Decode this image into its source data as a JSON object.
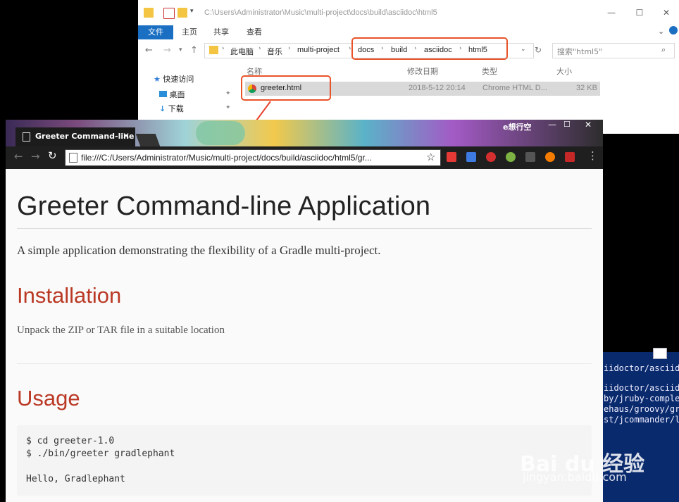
{
  "explorer": {
    "title": "C:\\Users\\Administrator\\Music\\multi-project\\docs\\build\\asciidoc\\html5",
    "ribbon": {
      "file": "文件",
      "home": "主页",
      "share": "共享",
      "view": "查看"
    },
    "breadcrumbs": [
      "此电脑",
      "音乐",
      "multi-project",
      "docs",
      "build",
      "asciidoc",
      "html5"
    ],
    "search_placeholder": "搜索\"html5\"",
    "nav": {
      "quick_access": "快速访问",
      "desktop": "桌面",
      "downloads": "下载"
    },
    "columns": {
      "name": "名称",
      "modified": "修改日期",
      "type": "类型",
      "size": "大小"
    },
    "file": {
      "name": "greeter.html",
      "modified": "2018-5-12 20:14",
      "type": "Chrome HTML D...",
      "size": "32 KB"
    },
    "window_controls": {
      "minimize": "—",
      "maximize": "☐",
      "close": "✕"
    }
  },
  "browser": {
    "tab_title": "Greeter Command-line",
    "url": "file:///C:/Users/Administrator/Music/multi-project/docs/build/asciidoc/html5/gr...",
    "profile_name": "e想行空",
    "extensions": [
      "#e53935",
      "#3d7be0",
      "#d32f2f",
      "#7cb342",
      "#555555",
      "#f57c00",
      "#c62828"
    ]
  },
  "page": {
    "title": "Greeter Command-line Application",
    "intro": "A simple application demonstrating the flexibility of a Gradle multi-project.",
    "installation_heading": "Installation",
    "installation_text": "Unpack the ZIP or TAR file in a suitable location",
    "usage_heading": "Usage",
    "code": [
      "$ cd greeter-1.0",
      "$ ./bin/greeter gradlephant",
      "",
      "Hello, Gradlephant"
    ]
  },
  "terminal": {
    "lines": [
      "iidoctor/asciid",
      "",
      "iidoctor/asciid",
      "by/jruby-complet",
      "ehaus/groovy/gr",
      "st/jcommander/l"
    ]
  },
  "watermark": {
    "main": "Bai du 经验",
    "sub": "jingyan.baidu.com"
  }
}
